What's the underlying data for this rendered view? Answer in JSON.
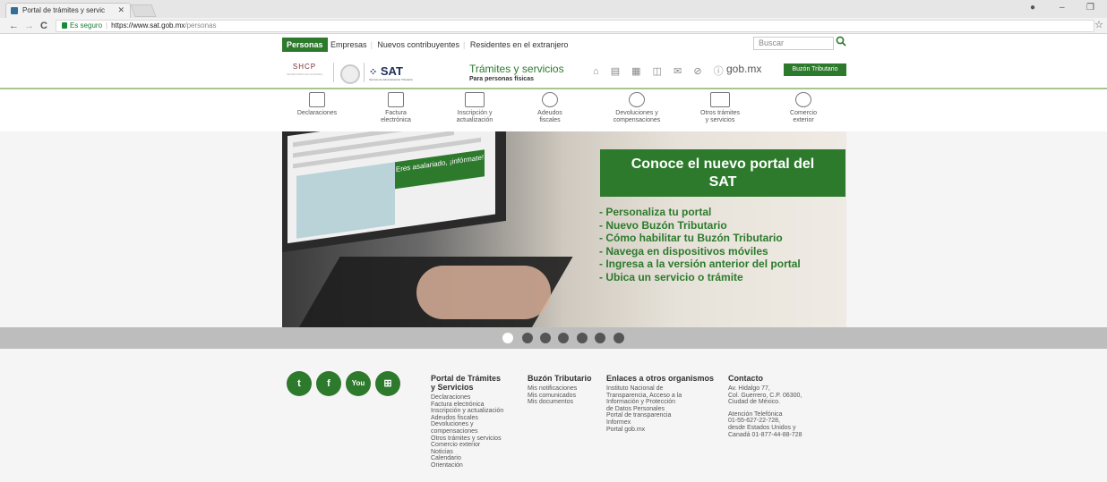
{
  "browser": {
    "tab_title": "Portal de trámites y servic",
    "tab_close": "✕",
    "back": "←",
    "forward": "→",
    "reload": "C",
    "secure_label": "Es seguro",
    "url_host": "https://www.sat.gob.mx",
    "url_path": "/personas",
    "bookmark": "☆",
    "account_icon": "●",
    "minimize": "–",
    "maximize": "❐"
  },
  "topnav": {
    "tabs": [
      "Personas",
      "Empresas",
      "Nuevos contribuyentes",
      "Residentes en el extranjero"
    ],
    "search_placeholder": "Buscar"
  },
  "brand": {
    "shcp": "SHCP",
    "sat": "SAT",
    "title": "Trámites y servicios",
    "subtitle": "Para personas físicas",
    "gobmx": "gob.mx",
    "buzon": "Buzón Tributario",
    "util_icons": "⌂ ▤ ▦ ◫ ✉ ⊘ ⓘ"
  },
  "categories": [
    {
      "line1": "Declaraciones",
      "line2": ""
    },
    {
      "line1": "Factura",
      "line2": "electrónica"
    },
    {
      "line1": "Inscripción y",
      "line2": "actualización"
    },
    {
      "line1": "Adeudos",
      "line2": "fiscales"
    },
    {
      "line1": "Devoluciones y",
      "line2": "compensaciones"
    },
    {
      "line1": "Otros trámites",
      "line2": "y servicios"
    },
    {
      "line1": "Comercio",
      "line2": "exterior"
    }
  ],
  "banner": {
    "promo_line1": "Conoce el nuevo portal del",
    "promo_line2": "SAT",
    "items": [
      "- Personaliza tu portal",
      "- Nuevo Buzón Tributario",
      "- Cómo habilitar tu Buzón Tributario",
      "- Navega en dispositivos móviles",
      "- Ingresa a la versión anterior del portal",
      "- Ubica un servicio o trámite"
    ],
    "screen_text": "Eres asalariado, ¡infórmate!"
  },
  "footer": {
    "social": [
      "t",
      "f",
      "You",
      "⊞"
    ],
    "col1_title": [
      "Portal de Trámites",
      "y Servicios"
    ],
    "col1_items": [
      "Declaraciones",
      "Factura electrónica",
      "Inscripción y actualización",
      "Adeudos fiscales",
      "Devoluciones y",
      "compensaciones",
      "Otros trámites y servicios",
      "Comercio exterior",
      "Noticias",
      "Calendario",
      "Orientación"
    ],
    "col2_title": [
      "Buzón Tributario"
    ],
    "col2_items": [
      "Mis notificaciones",
      "Mis comunicados",
      "Mis documentos"
    ],
    "col3_title": [
      "Enlaces a otros organismos"
    ],
    "col3_items": [
      "Instituto Nacional de",
      "Transparencia, Acceso a la",
      "Información y Protección",
      "de Datos Personales",
      "Portal de transparencia",
      "Informex",
      "Portal gob.mx"
    ],
    "col4_title": [
      "Contacto"
    ],
    "col4_items": [
      "Av. Hidalgo 77,",
      "Col. Guerrero, C.P. 06300,",
      "Ciudad de México.",
      "",
      "Atención Telefónica",
      "01-55-627-22-728,",
      "desde Estados Unidos y",
      "Canadá 01-877-44-88-728"
    ]
  }
}
